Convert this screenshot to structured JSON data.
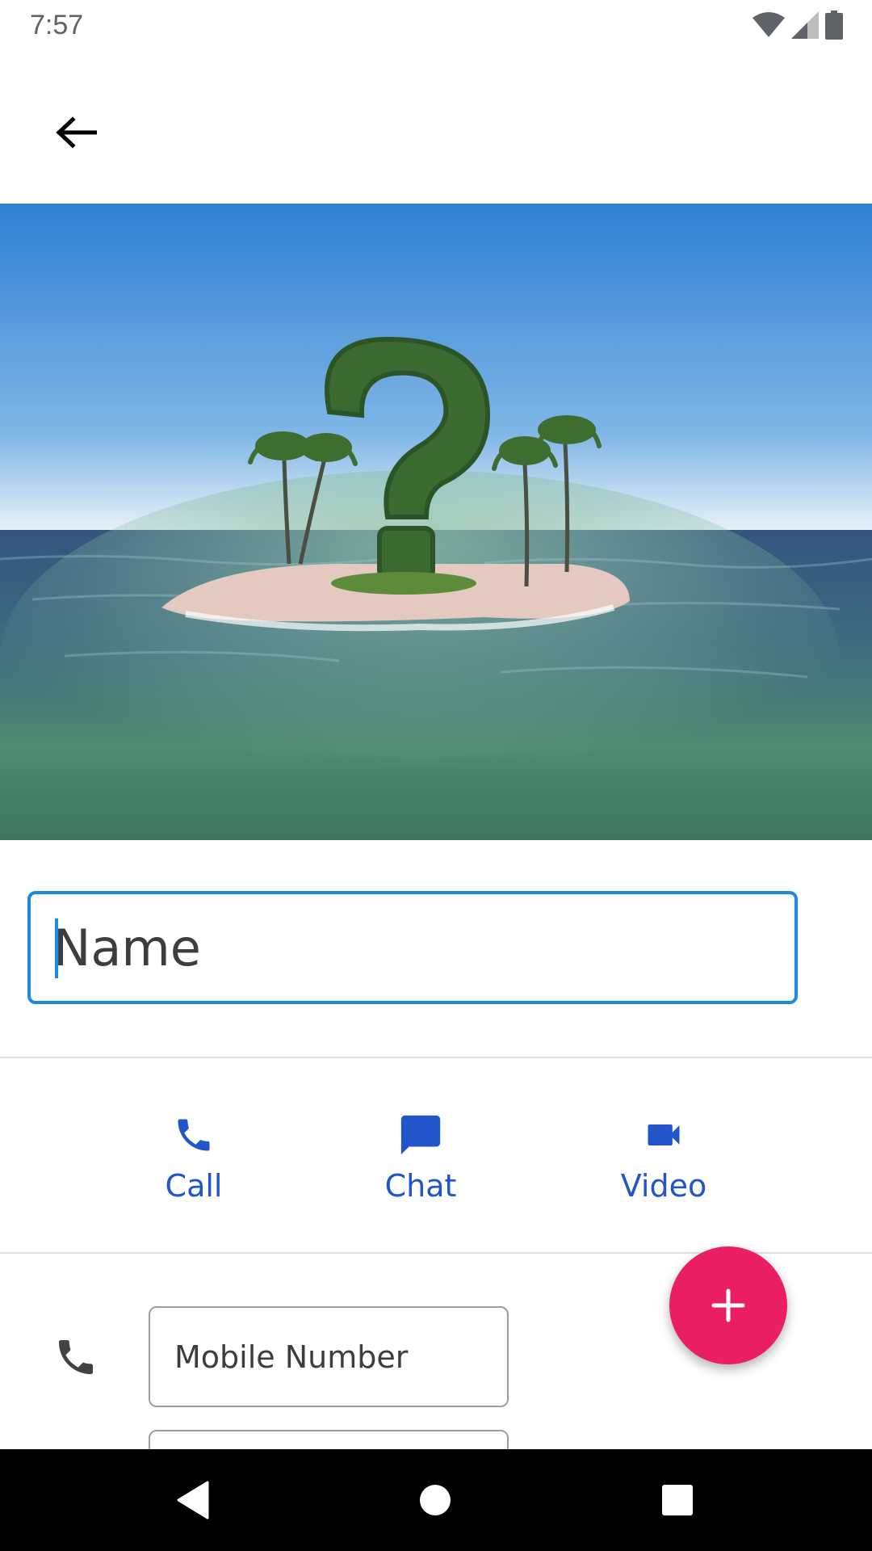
{
  "status_bar": {
    "time": "7:57",
    "icons": [
      "wifi-icon",
      "cellular-signal-icon",
      "battery-icon"
    ]
  },
  "top_bar": {
    "back_icon": "arrow-left-icon"
  },
  "hero_image": {
    "subject": "photo"
  },
  "name_field": {
    "placeholder": "Name",
    "value": ""
  },
  "actions": [
    {
      "label": "Call",
      "icon": "phone-icon"
    },
    {
      "label": "Chat",
      "icon": "chat-bubble-icon"
    },
    {
      "label": "Video",
      "icon": "videocam-icon"
    }
  ],
  "phone_section": {
    "icon": "phone-icon",
    "mobile_placeholder": "Mobile Number",
    "second_placeholder": ""
  },
  "fab": {
    "icon": "plus-icon"
  },
  "nav_bar": {
    "buttons": [
      "back-triangle-icon",
      "home-circle-icon",
      "recents-square-icon"
    ]
  },
  "colors": {
    "accent_blue": "#2155c9",
    "focus_blue": "#1e88e5",
    "fab_pink": "#e91e63",
    "text_dark": "#212121"
  }
}
